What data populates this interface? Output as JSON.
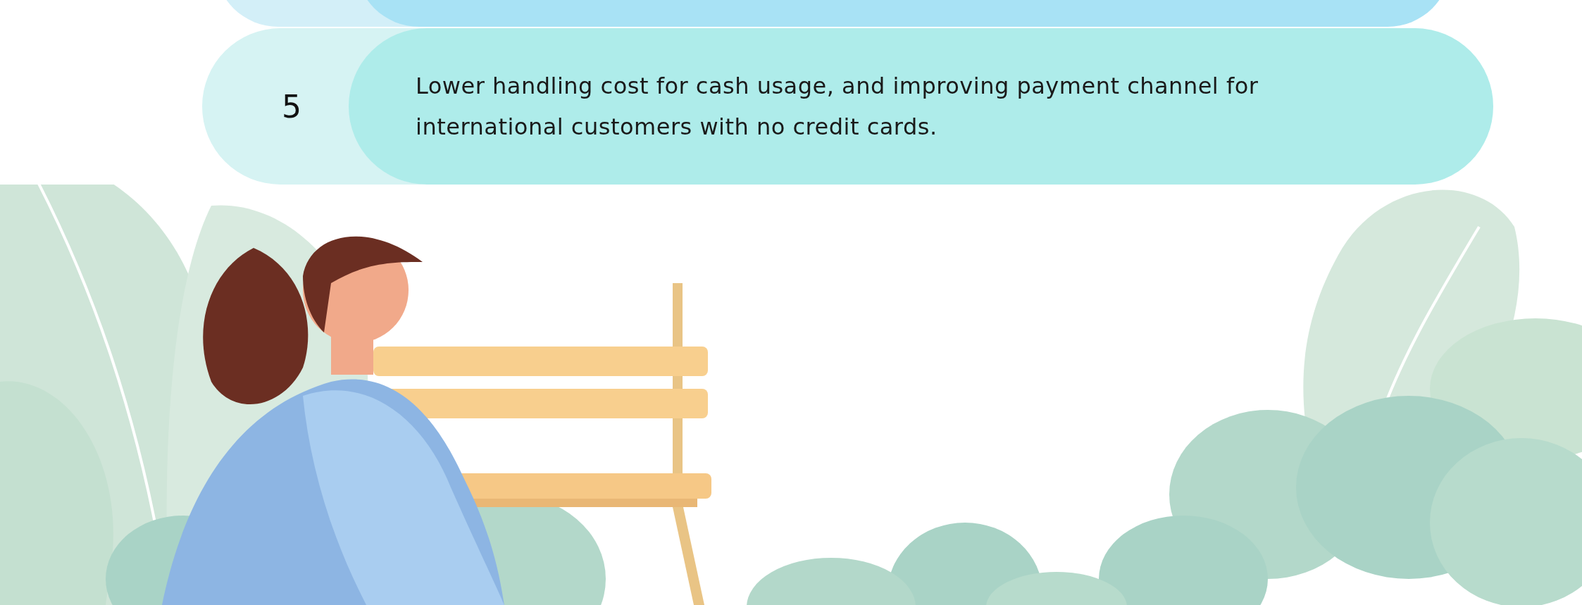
{
  "steps": [
    {
      "number": "5",
      "text": "Lower handling cost for cash usage, and improving payment channel for international customers with no credit cards."
    }
  ]
}
